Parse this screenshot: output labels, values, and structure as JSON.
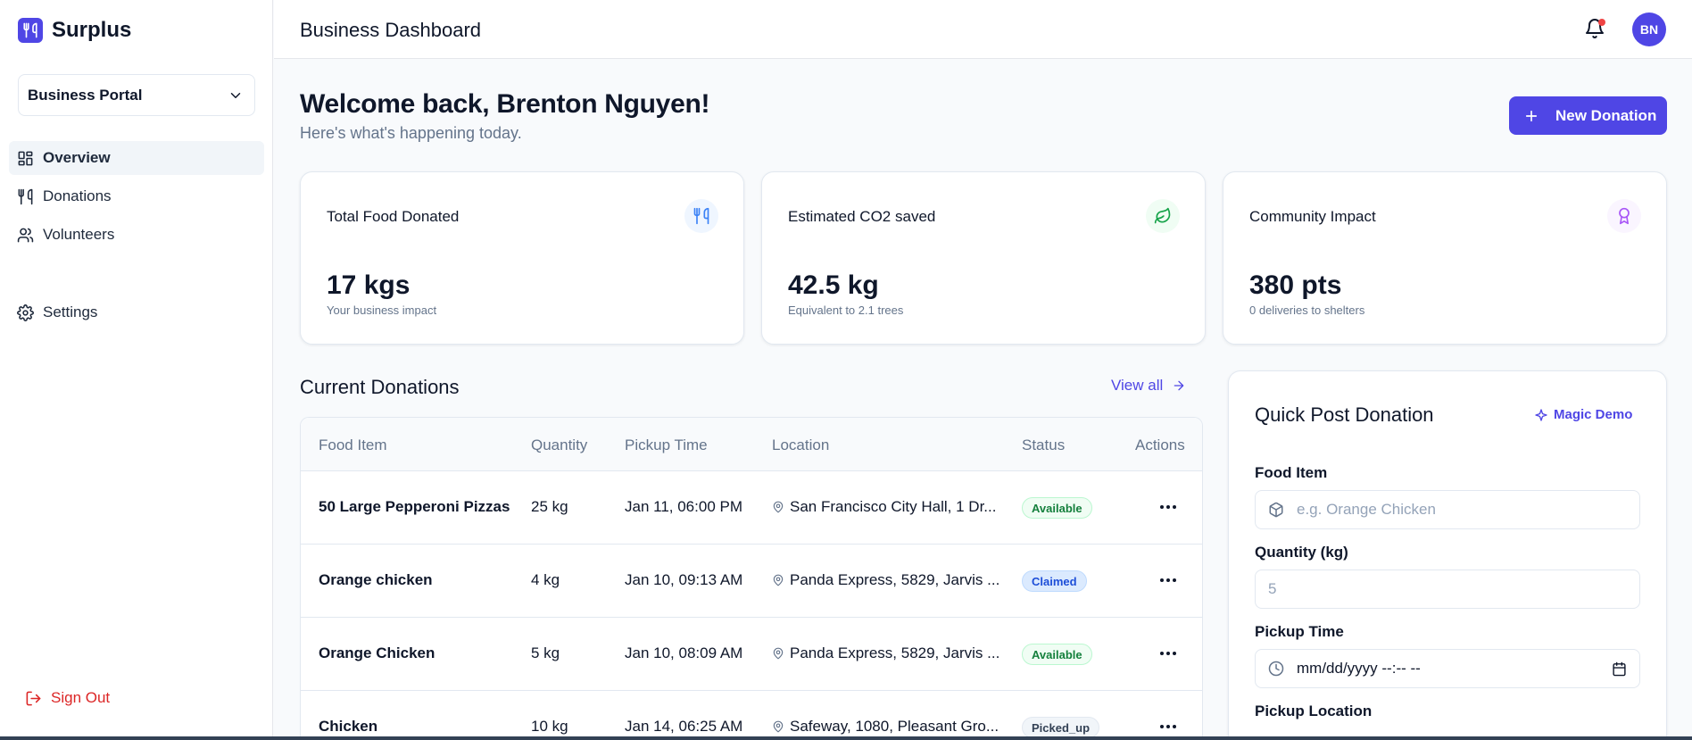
{
  "sidebar": {
    "brand": "Surplus",
    "portal": "Business Portal",
    "items": [
      {
        "label": "Overview",
        "icon": "layout-grid-icon",
        "active": true
      },
      {
        "label": "Donations",
        "icon": "utensils-icon"
      },
      {
        "label": "Volunteers",
        "icon": "users-icon"
      }
    ],
    "settings": "Settings",
    "sign_out": "Sign Out"
  },
  "header": {
    "title": "Business Dashboard",
    "avatar_initials": "BN"
  },
  "main": {
    "welcome": "Welcome back, Brenton Nguyen!",
    "subtitle": "Here's what's happening today.",
    "new_donation": "New Donation",
    "stats": [
      {
        "title": "Total Food Donated",
        "value": "17 kgs",
        "sub": "Your business impact",
        "icon": "utensils-icon",
        "color": "#3b82f6"
      },
      {
        "title": "Estimated CO2 saved",
        "value": "42.5 kg",
        "sub": "Equivalent to 2.1 trees",
        "icon": "leaf-icon",
        "color": "#16a34a"
      },
      {
        "title": "Community Impact",
        "value": "380 pts",
        "sub": "0 deliveries to shelters",
        "icon": "award-icon",
        "color": "#a855f7"
      }
    ],
    "donations_title": "Current Donations",
    "view_all": "View all",
    "table": {
      "headers": [
        "Food Item",
        "Quantity",
        "Pickup Time",
        "Location",
        "Status",
        "Actions"
      ],
      "rows": [
        {
          "item": "50 Large Pepperoni Pizzas",
          "qty": "25 kg",
          "time": "Jan 11, 06:00 PM",
          "location": "San Francisco City Hall, 1 Dr...",
          "status": "Available"
        },
        {
          "item": "Orange chicken",
          "qty": "4 kg",
          "time": "Jan 10, 09:13 AM",
          "location": "Panda Express, 5829, Jarvis ...",
          "status": "Claimed"
        },
        {
          "item": "Orange Chicken",
          "qty": "5 kg",
          "time": "Jan 10, 08:09 AM",
          "location": "Panda Express, 5829, Jarvis ...",
          "status": "Available"
        },
        {
          "item": "Chicken",
          "qty": "10 kg",
          "time": "Jan 14, 06:25 AM",
          "location": "Safeway, 1080, Pleasant Gro...",
          "status": "Picked_up"
        }
      ]
    }
  },
  "quick_post": {
    "title": "Quick Post Donation",
    "magic_demo": "Magic Demo",
    "food_label": "Food Item",
    "food_placeholder": "e.g. Orange Chicken",
    "qty_label": "Quantity (kg)",
    "qty_placeholder": "5",
    "time_label": "Pickup Time",
    "time_placeholder": "mm/dd/yyyy --:-- --",
    "location_label": "Pickup Location"
  },
  "colors": {
    "accent": "#4f46e5",
    "danger": "#dc2626"
  }
}
